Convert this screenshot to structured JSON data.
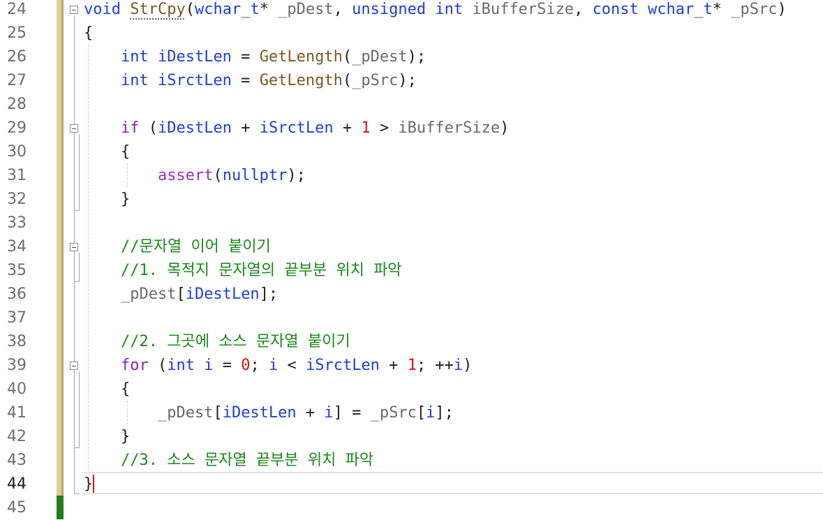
{
  "editor": {
    "line_numbers": [
      "24",
      "25",
      "26",
      "27",
      "28",
      "29",
      "30",
      "31",
      "32",
      "33",
      "34",
      "35",
      "36",
      "37",
      "38",
      "39",
      "40",
      "41",
      "42",
      "43",
      "44",
      "45"
    ],
    "current_line": "44",
    "lines": [
      [
        {
          "t": "void ",
          "c": "kw"
        },
        {
          "t": "StrCpy",
          "c": "fn squig"
        },
        {
          "t": "(",
          "c": ""
        },
        {
          "t": "wchar_t",
          "c": "kw"
        },
        {
          "t": "* ",
          "c": ""
        },
        {
          "t": "_pDest",
          "c": "param"
        },
        {
          "t": ", ",
          "c": ""
        },
        {
          "t": "unsigned int ",
          "c": "kw"
        },
        {
          "t": "iBufferSize",
          "c": "param"
        },
        {
          "t": ", ",
          "c": ""
        },
        {
          "t": "const wchar_t",
          "c": "kw"
        },
        {
          "t": "* ",
          "c": ""
        },
        {
          "t": "_pSrc",
          "c": "param"
        },
        {
          "t": ")",
          "c": ""
        }
      ],
      [
        {
          "t": "{",
          "c": ""
        }
      ],
      [
        {
          "t": "    ",
          "c": ""
        },
        {
          "t": "int ",
          "c": "kw"
        },
        {
          "t": "iDestLen",
          "c": "loc"
        },
        {
          "t": " = ",
          "c": ""
        },
        {
          "t": "GetLength",
          "c": "fn"
        },
        {
          "t": "(",
          "c": ""
        },
        {
          "t": "_pDest",
          "c": "param"
        },
        {
          "t": ");",
          "c": ""
        }
      ],
      [
        {
          "t": "    ",
          "c": ""
        },
        {
          "t": "int ",
          "c": "kw"
        },
        {
          "t": "iSrctLen",
          "c": "loc"
        },
        {
          "t": " = ",
          "c": ""
        },
        {
          "t": "GetLength",
          "c": "fn"
        },
        {
          "t": "(",
          "c": ""
        },
        {
          "t": "_pSrc",
          "c": "param"
        },
        {
          "t": ");",
          "c": ""
        }
      ],
      [],
      [
        {
          "t": "    ",
          "c": ""
        },
        {
          "t": "if",
          "c": "ctl"
        },
        {
          "t": " (",
          "c": ""
        },
        {
          "t": "iDestLen",
          "c": "loc"
        },
        {
          "t": " + ",
          "c": ""
        },
        {
          "t": "iSrctLen",
          "c": "loc"
        },
        {
          "t": " + ",
          "c": ""
        },
        {
          "t": "1",
          "c": "num"
        },
        {
          "t": " > ",
          "c": ""
        },
        {
          "t": "iBufferSize",
          "c": "param"
        },
        {
          "t": ")",
          "c": ""
        }
      ],
      [
        {
          "t": "    {",
          "c": ""
        }
      ],
      [
        {
          "t": "        ",
          "c": ""
        },
        {
          "t": "assert",
          "c": "mac"
        },
        {
          "t": "(",
          "c": ""
        },
        {
          "t": "nullptr",
          "c": "kw"
        },
        {
          "t": ");",
          "c": ""
        }
      ],
      [
        {
          "t": "    }",
          "c": ""
        }
      ],
      [],
      [
        {
          "t": "    ",
          "c": ""
        },
        {
          "t": "//문자열 이어 붙이기",
          "c": "cmt"
        }
      ],
      [
        {
          "t": "    ",
          "c": ""
        },
        {
          "t": "//1. 목적지 문자열의 끝부분 위치 파악",
          "c": "cmt"
        }
      ],
      [
        {
          "t": "    ",
          "c": ""
        },
        {
          "t": "_pDest",
          "c": "param"
        },
        {
          "t": "[",
          "c": ""
        },
        {
          "t": "iDestLen",
          "c": "loc"
        },
        {
          "t": "];",
          "c": ""
        }
      ],
      [],
      [
        {
          "t": "    ",
          "c": ""
        },
        {
          "t": "//2. 그곳에 소스 문자열 붙이기",
          "c": "cmt"
        }
      ],
      [
        {
          "t": "    ",
          "c": ""
        },
        {
          "t": "for",
          "c": "ctl"
        },
        {
          "t": " (",
          "c": ""
        },
        {
          "t": "int ",
          "c": "kw"
        },
        {
          "t": "i",
          "c": "loc"
        },
        {
          "t": " = ",
          "c": ""
        },
        {
          "t": "0",
          "c": "num"
        },
        {
          "t": "; ",
          "c": ""
        },
        {
          "t": "i",
          "c": "loc"
        },
        {
          "t": " < ",
          "c": ""
        },
        {
          "t": "iSrctLen",
          "c": "loc"
        },
        {
          "t": " + ",
          "c": ""
        },
        {
          "t": "1",
          "c": "num"
        },
        {
          "t": "; ++",
          "c": ""
        },
        {
          "t": "i",
          "c": "loc"
        },
        {
          "t": ")",
          "c": ""
        }
      ],
      [
        {
          "t": "    {",
          "c": ""
        }
      ],
      [
        {
          "t": "        ",
          "c": ""
        },
        {
          "t": "_pDest",
          "c": "param"
        },
        {
          "t": "[",
          "c": ""
        },
        {
          "t": "iDestLen",
          "c": "loc"
        },
        {
          "t": " + ",
          "c": ""
        },
        {
          "t": "i",
          "c": "loc"
        },
        {
          "t": "] = ",
          "c": ""
        },
        {
          "t": "_pSrc",
          "c": "param"
        },
        {
          "t": "[",
          "c": ""
        },
        {
          "t": "i",
          "c": "loc"
        },
        {
          "t": "];",
          "c": ""
        }
      ],
      [
        {
          "t": "    }",
          "c": ""
        }
      ],
      [
        {
          "t": "    ",
          "c": ""
        },
        {
          "t": "//3. 소스 문자열 끝부분 위치 파악",
          "c": "cmt"
        }
      ],
      [
        {
          "t": "}",
          "c": ""
        }
      ],
      []
    ]
  },
  "colors": {
    "keyword": "#1f3fd6",
    "control": "#8a1fb0",
    "function": "#7a5a1e",
    "parameter": "#6a6a6a",
    "number": "#e01010",
    "comment": "#178a17",
    "saved_change_bar": "#d8cf9b",
    "unsaved_change_bar": "#1f7f1f"
  },
  "icons": [
    "collapse-box-icon"
  ]
}
